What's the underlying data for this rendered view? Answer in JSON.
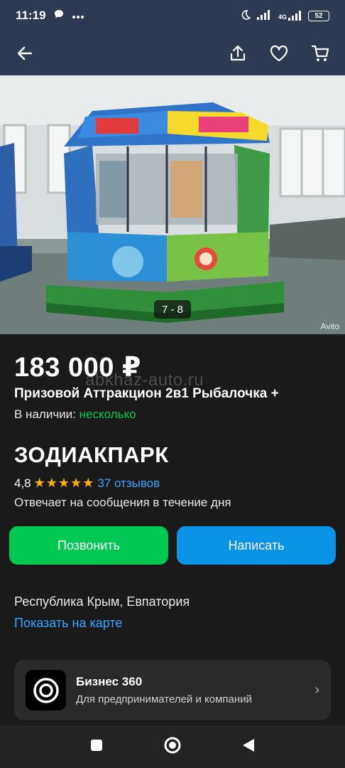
{
  "status_bar": {
    "time": "11:19",
    "network": "4G",
    "battery": "52",
    "icons": [
      "chat-icon",
      "more-dots-icon",
      "moon-icon",
      "signal-icon",
      "signal-4g-icon",
      "battery-icon"
    ]
  },
  "app_bar": {
    "icons": [
      "back-arrow-icon",
      "share-icon",
      "heart-icon",
      "cart-icon"
    ]
  },
  "gallery": {
    "counter": "7 - 8",
    "watermark": "Avito"
  },
  "listing": {
    "price": "183 000 ₽",
    "site_watermark": "abkhaz-auto.ru",
    "title": "Призовой Аттракцион 2в1 Рыбалочка +",
    "stock_label": "В наличии: ",
    "stock_value": "несколько"
  },
  "seller": {
    "name": "ЗОДИАКПАРК",
    "rating": "4,8",
    "stars": "★★★★★",
    "reviews": "37 отзывов",
    "responds": "Отвечает на сообщения в течение дня"
  },
  "actions": {
    "call_label": "Позвонить",
    "write_label": "Написать"
  },
  "location": {
    "address": "Республика Крым, Евпатория",
    "map_link": "Показать на карте"
  },
  "business": {
    "title": "Бизнес 360",
    "subtitle": "Для предпринимателей и компаний",
    "chevron": "›"
  },
  "colors": {
    "header_bg": "#2e3a52",
    "page_bg": "#1a1a1a",
    "green": "#00c853",
    "blue": "#0a94e6",
    "link": "#3aa4ff",
    "star": "#ffb300"
  }
}
